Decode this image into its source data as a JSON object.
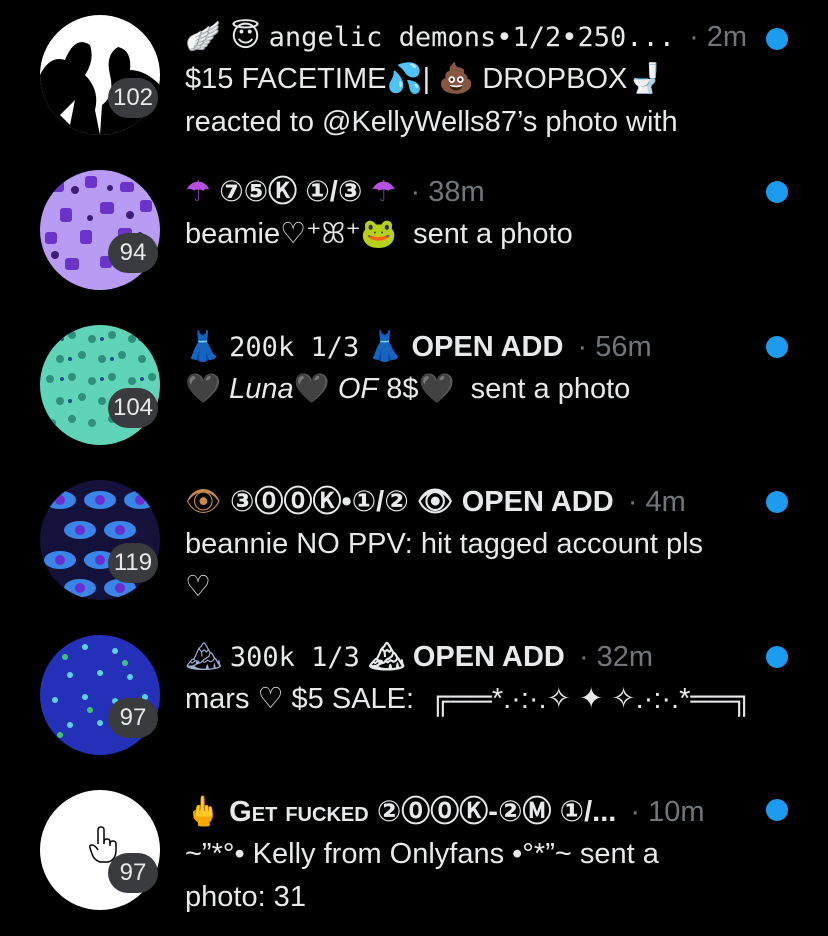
{
  "accent_color": "#1d9bf0",
  "time_color": "#71767b",
  "conversations": [
    {
      "prefix": "🪽 😇",
      "name": "angelic demons•1/2•250...",
      "time": "· 2m",
      "unread": true,
      "count": "102",
      "message": "$15 FACETIME💦| 💩 DROPBOX🚽\nreacted to @KellyWells87’s photo with"
    },
    {
      "prefix": "☂",
      "name": "⑦⑤Ⓚ ①/③",
      "suffix": "☂",
      "time": "· 38m",
      "unread": true,
      "count": "94",
      "message": "beamie♡⁺ꕤ⁺🐸  sent a photo"
    },
    {
      "prefix": "👗",
      "name": "200k 1/3",
      "suffix": "👗 OPEN ADD",
      "time": "· 56m",
      "unread": true,
      "count": "104",
      "message_parts": [
        "🖤 ",
        "Luna",
        "🖤 ",
        "OF",
        " 8$🖤  sent a photo"
      ]
    },
    {
      "prefix": "👁",
      "name": "③⓪⓪Ⓚ•①/②",
      "suffix": "👁 OPEN ADD",
      "time": "· 4m",
      "unread": true,
      "count": "119",
      "message": "beannie NO PPV: hit tagged account pls\n♡"
    },
    {
      "prefix": "🏔",
      "name": "300k 1/3",
      "suffix": "🏔 OPEN ADD",
      "time": "· 32m",
      "unread": true,
      "count": "97",
      "message": "mars ♡ $5 SALE:  ╔══*.·:·.✧ ✦ ✧.·:·.*══╗"
    },
    {
      "prefix": "🖕",
      "name": "Get fucked ②⓪⓪Ⓚ-②Ⓜ ①/...",
      "time": "· 10m",
      "unread": true,
      "count": "97",
      "message": "~”*°• Kelly from Onlyfans •°*”~ sent a\nphoto: 31"
    }
  ]
}
